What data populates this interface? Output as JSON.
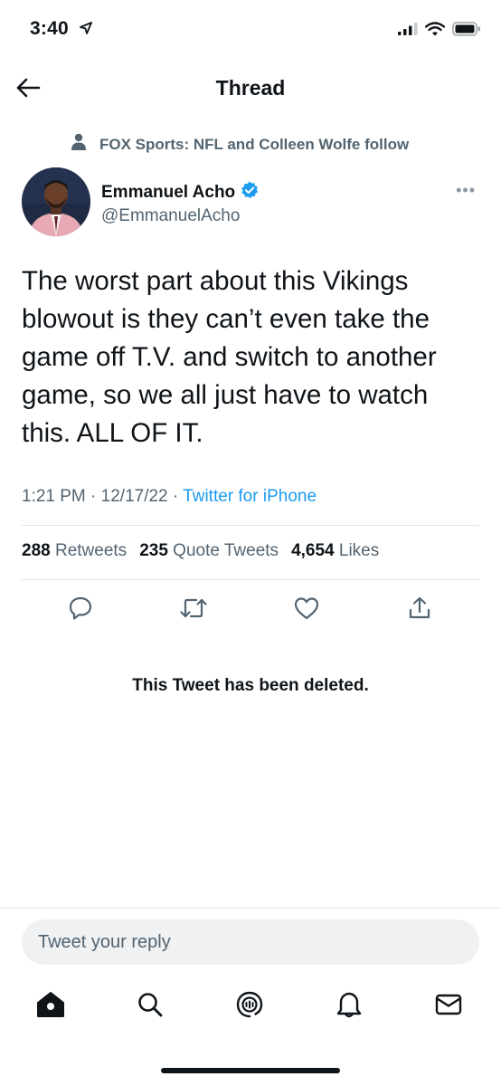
{
  "status_bar": {
    "time": "3:40",
    "icons": [
      "location-arrow-icon",
      "signal-icon",
      "wifi-icon",
      "battery-icon"
    ]
  },
  "header": {
    "title": "Thread",
    "back_icon": "back-arrow-icon"
  },
  "tweet": {
    "social_context": "FOX Sports: NFL and Colleen Wolfe follow",
    "author": {
      "name": "Emmanuel Acho",
      "handle": "@EmmanuelAcho",
      "verified": true
    },
    "more_label": "•••",
    "text": "The worst part about this Vikings blowout is they can’t even take the game off T.V. and switch to another game, so we all just have to watch this. ALL OF IT.",
    "time": "1:21 PM",
    "date": "12/17/22",
    "separator": "·",
    "source": "Twitter for iPhone",
    "stats": {
      "retweets_count": "288",
      "retweets_label": "Retweets",
      "quotes_count": "235",
      "quotes_label": "Quote Tweets",
      "likes_count": "4,654",
      "likes_label": "Likes"
    },
    "actions": [
      "reply-icon",
      "retweet-icon",
      "like-icon",
      "share-icon"
    ]
  },
  "deleted_notice": "This Tweet has been deleted.",
  "reply": {
    "placeholder": "Tweet your reply"
  },
  "tab_bar": [
    "home-icon",
    "search-icon",
    "spaces-icon",
    "notifications-icon",
    "messages-icon"
  ],
  "colors": {
    "accent": "#1d9bf0",
    "text_primary": "#0f1419",
    "text_secondary": "#536471",
    "divider": "#e1e6ea",
    "input_bg": "#eff1f3"
  }
}
